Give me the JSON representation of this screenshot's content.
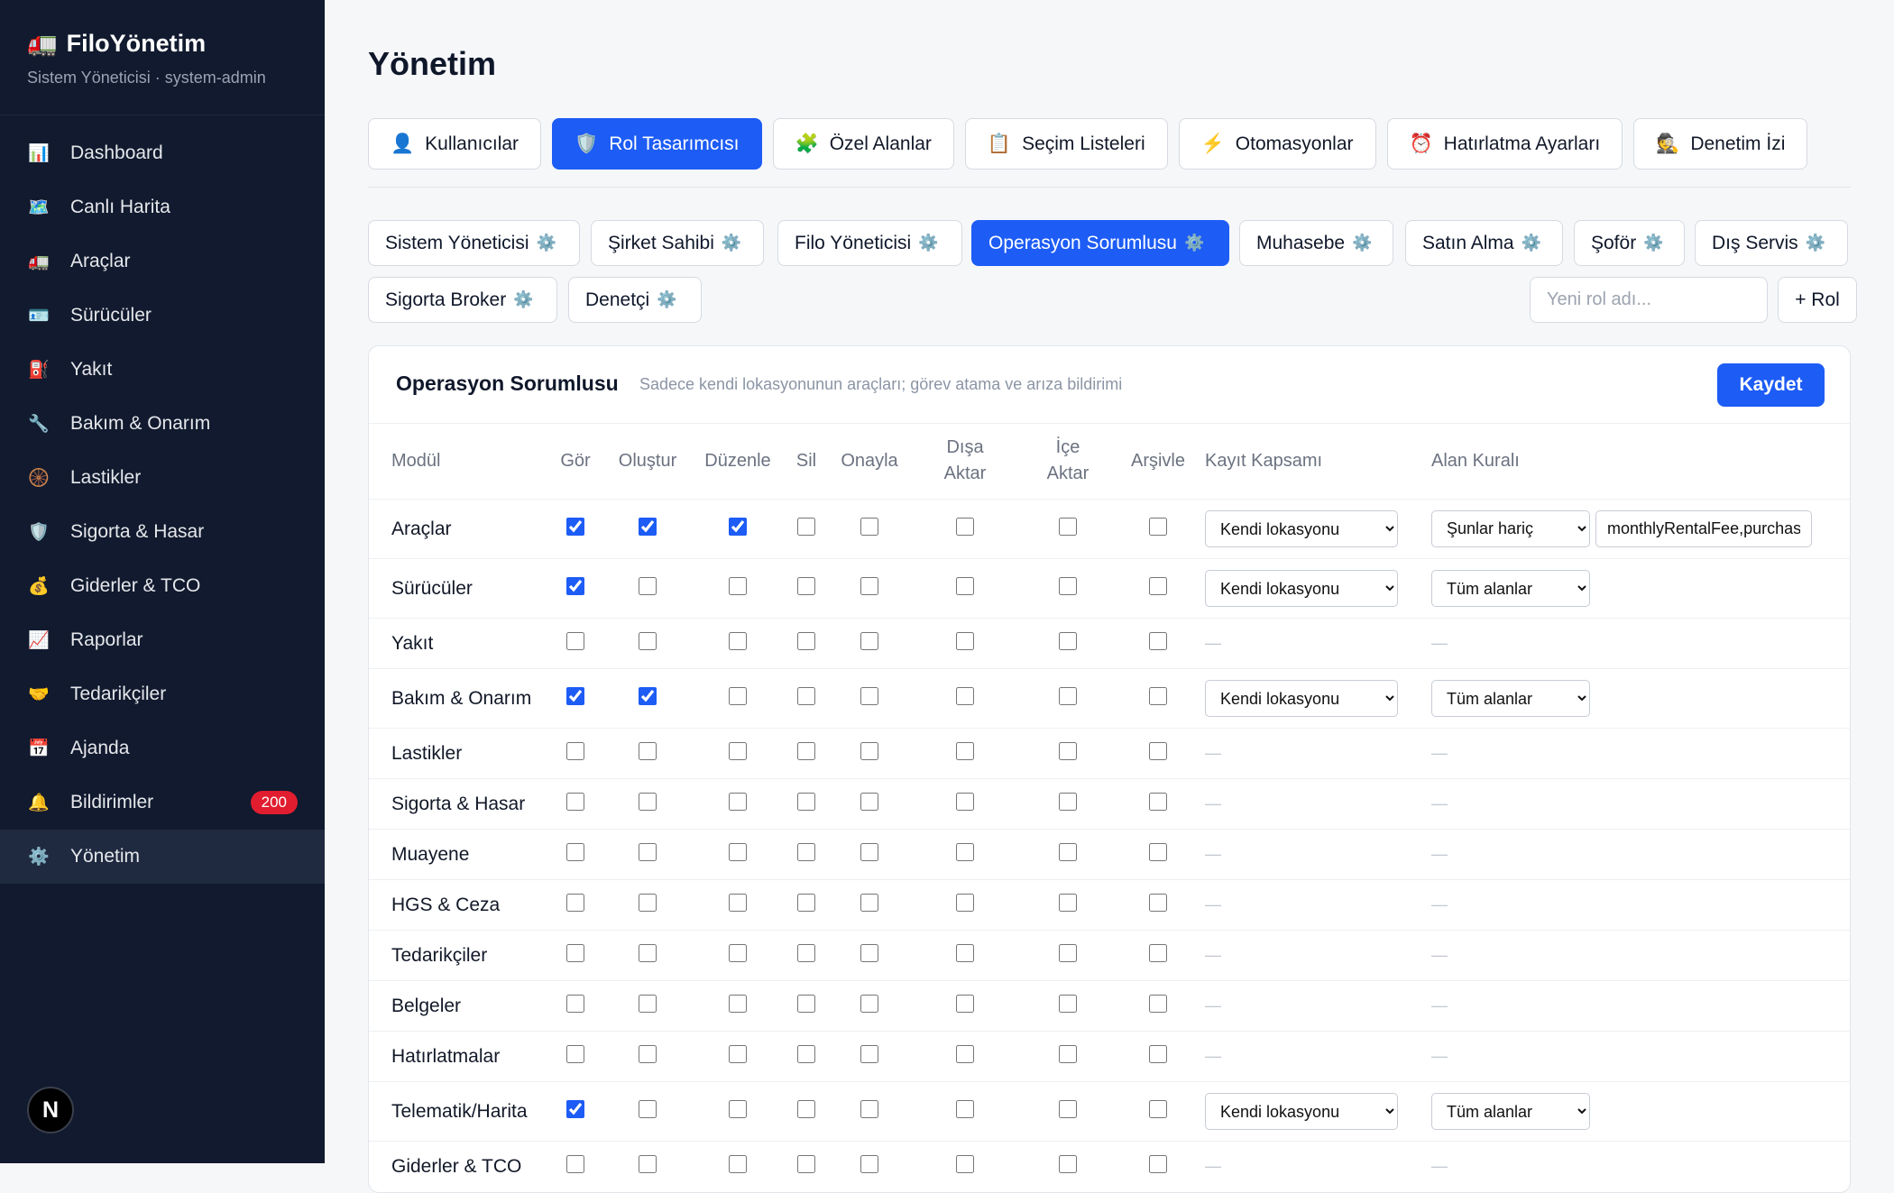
{
  "app": {
    "name": "FiloYönetim",
    "subtitle": "Sistem Yöneticisi · system-admin",
    "logo_icon": "truck-icon"
  },
  "sidebar": {
    "items": [
      {
        "label": "Dashboard",
        "icon": "📊",
        "name": "sidebar-item-dashboard"
      },
      {
        "label": "Canlı Harita",
        "icon": "🗺️",
        "name": "sidebar-item-live-map"
      },
      {
        "label": "Araçlar",
        "icon": "🚛",
        "name": "sidebar-item-vehicles"
      },
      {
        "label": "Sürücüler",
        "icon": "🪪",
        "name": "sidebar-item-drivers"
      },
      {
        "label": "Yakıt",
        "icon": "⛽",
        "name": "sidebar-item-fuel"
      },
      {
        "label": "Bakım & Onarım",
        "icon": "🔧",
        "name": "sidebar-item-maintenance"
      },
      {
        "label": "Lastikler",
        "icon": "🛞",
        "name": "sidebar-item-tires"
      },
      {
        "label": "Sigorta & Hasar",
        "icon": "🛡️",
        "name": "sidebar-item-insurance"
      },
      {
        "label": "Giderler & TCO",
        "icon": "💰",
        "name": "sidebar-item-expenses"
      },
      {
        "label": "Raporlar",
        "icon": "📈",
        "name": "sidebar-item-reports"
      },
      {
        "label": "Tedarikçiler",
        "icon": "🤝",
        "name": "sidebar-item-suppliers"
      },
      {
        "label": "Ajanda",
        "icon": "📅",
        "name": "sidebar-item-agenda"
      },
      {
        "label": "Bildirimler",
        "icon": "🔔",
        "name": "sidebar-item-notifications",
        "badge": "200"
      },
      {
        "label": "Yönetim",
        "icon": "⚙️",
        "name": "sidebar-item-admin",
        "active": true
      }
    ],
    "footer_logo": "N"
  },
  "page": {
    "title": "Yönetim"
  },
  "tabs": [
    {
      "label": "Kullanıcılar",
      "icon": "👤"
    },
    {
      "label": "Rol Tasarımcısı",
      "icon": "🛡️",
      "active": true
    },
    {
      "label": "Özel Alanlar",
      "icon": "🧩"
    },
    {
      "label": "Seçim Listeleri",
      "icon": "📋"
    },
    {
      "label": "Otomasyonlar",
      "icon": "⚡"
    },
    {
      "label": "Hatırlatma Ayarları",
      "icon": "⏰"
    },
    {
      "label": "Denetim İzi",
      "icon": "🕵️"
    }
  ],
  "roles": [
    {
      "label": "Sistem Yöneticisi"
    },
    {
      "label": "Şirket Sahibi"
    },
    {
      "label": "Filo Yöneticisi"
    },
    {
      "label": "Operasyon Sorumlusu",
      "active": true
    },
    {
      "label": "Muhasebe"
    },
    {
      "label": "Satın Alma"
    },
    {
      "label": "Şoför"
    },
    {
      "label": "Dış Servis"
    },
    {
      "label": "Sigorta Broker"
    },
    {
      "label": "Denetçi"
    }
  ],
  "role_gear_icon": "⚙️",
  "new_role": {
    "placeholder": "Yeni rol adı...",
    "add_label": "+ Rol"
  },
  "editor": {
    "title": "Operasyon Sorumlusu",
    "description": "Sadece kendi lokasyonunun araçları; görev atama ve arıza bildirimi",
    "save_label": "Kaydet",
    "columns": {
      "module": "Modül",
      "view": "Gör",
      "create": "Oluştur",
      "edit": "Düzenle",
      "delete": "Sil",
      "approve": "Onayla",
      "export_1": "Dışa",
      "export_2": "Aktar",
      "import_1": "İçe",
      "import_2": "Aktar",
      "archive": "Arşivle",
      "scope": "Kayıt Kapsamı",
      "rule": "Alan Kuralı"
    },
    "empty_dash": "—",
    "rows": [
      {
        "module": "Araçlar",
        "perms": [
          true,
          true,
          true,
          false,
          false,
          false,
          false,
          false
        ],
        "scope": "Kendi lokasyonu",
        "rule": "Şunlar hariç",
        "fields": "monthlyRentalFee,purchasePrice"
      },
      {
        "module": "Sürücüler",
        "perms": [
          true,
          false,
          false,
          false,
          false,
          false,
          false,
          false
        ],
        "scope": "Kendi lokasyonu",
        "rule": "Tüm alanlar"
      },
      {
        "module": "Yakıt",
        "perms": [
          false,
          false,
          false,
          false,
          false,
          false,
          false,
          false
        ]
      },
      {
        "module": "Bakım & Onarım",
        "perms": [
          true,
          true,
          false,
          false,
          false,
          false,
          false,
          false
        ],
        "scope": "Kendi lokasyonu",
        "rule": "Tüm alanlar"
      },
      {
        "module": "Lastikler",
        "perms": [
          false,
          false,
          false,
          false,
          false,
          false,
          false,
          false
        ]
      },
      {
        "module": "Sigorta & Hasar",
        "perms": [
          false,
          false,
          false,
          false,
          false,
          false,
          false,
          false
        ]
      },
      {
        "module": "Muayene",
        "perms": [
          false,
          false,
          false,
          false,
          false,
          false,
          false,
          false
        ]
      },
      {
        "module": "HGS & Ceza",
        "perms": [
          false,
          false,
          false,
          false,
          false,
          false,
          false,
          false
        ]
      },
      {
        "module": "Tedarikçiler",
        "perms": [
          false,
          false,
          false,
          false,
          false,
          false,
          false,
          false
        ]
      },
      {
        "module": "Belgeler",
        "perms": [
          false,
          false,
          false,
          false,
          false,
          false,
          false,
          false
        ]
      },
      {
        "module": "Hatırlatmalar",
        "perms": [
          false,
          false,
          false,
          false,
          false,
          false,
          false,
          false
        ]
      },
      {
        "module": "Telematik/Harita",
        "perms": [
          true,
          false,
          false,
          false,
          false,
          false,
          false,
          false
        ],
        "scope": "Kendi lokasyonu",
        "rule": "Tüm alanlar"
      },
      {
        "module": "Giderler & TCO",
        "perms": [
          false,
          false,
          false,
          false,
          false,
          false,
          false,
          false
        ]
      }
    ]
  },
  "colors": {
    "sidebar_bg": "#111a2e",
    "accent": "#1d5cf5",
    "badge": "#e11d2f"
  }
}
